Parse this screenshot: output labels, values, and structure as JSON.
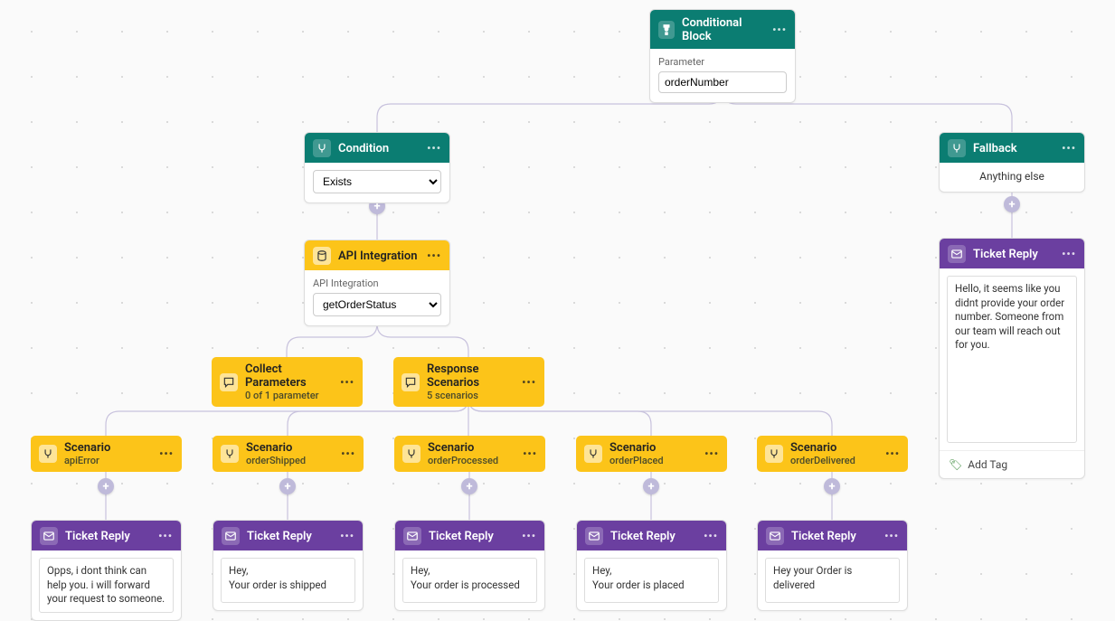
{
  "conditional_block": {
    "title": "Conditional Block",
    "param_label": "Parameter",
    "param_value": "orderNumber"
  },
  "condition": {
    "title": "Condition",
    "selected": "Exists"
  },
  "fallback": {
    "title": "Fallback",
    "text": "Anything else"
  },
  "api": {
    "title": "API Integration",
    "field_label": "API Integration",
    "selected": "getOrderStatus"
  },
  "collect": {
    "title": "Collect Parameters",
    "sub": "0 of 1 parameter"
  },
  "resp": {
    "title": "Response Scenarios",
    "sub": "5 scenarios"
  },
  "scenarios": [
    {
      "title": "Scenario",
      "name": "apiError"
    },
    {
      "title": "Scenario",
      "name": "orderShipped"
    },
    {
      "title": "Scenario",
      "name": "orderProcessed"
    },
    {
      "title": "Scenario",
      "name": "orderPlaced"
    },
    {
      "title": "Scenario",
      "name": "orderDelivered"
    }
  ],
  "ticket_reply_label": "Ticket Reply",
  "replies": {
    "fallback": "Hello, it seems like you didnt provide your order number. Someone from our team will reach out for you.",
    "s1": "Opps, i dont think can help you. i will forward your request to someone.",
    "s2": "Hey,\nYour order is shipped",
    "s3": "Hey,\nYour order is processed",
    "s4": "Hey,\nYour order is placed",
    "s5": "Hey your Order is delivered"
  },
  "add_tag": "Add Tag",
  "icons": {
    "branch": "branch",
    "db": "database",
    "chat": "chat",
    "mail": "mail",
    "more": "•••"
  }
}
